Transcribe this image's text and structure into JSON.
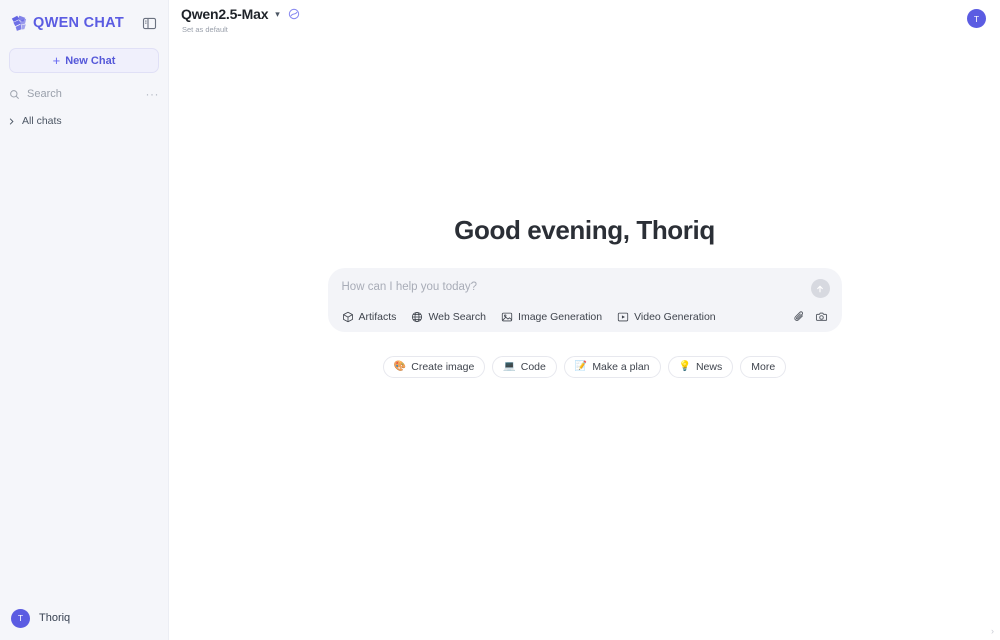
{
  "sidebar": {
    "logo_text": "QWEN CHAT",
    "panel_toggle_name": "panel-toggle-icon",
    "new_chat_label": "New Chat",
    "new_chat_plus": "+",
    "search_placeholder": "Search",
    "search_more": "···",
    "all_chats_label": "All chats",
    "profile": {
      "initial": "T",
      "name": "Thoriq"
    }
  },
  "topbar": {
    "model_name": "Qwen2.5-Max",
    "chevron": "▾",
    "set_as_default": "Set as default",
    "avatar_initial": "T"
  },
  "main": {
    "greeting": "Good evening, Thoriq",
    "composer": {
      "placeholder": "How can I help you today?",
      "send_label": "↑",
      "tools": [
        {
          "label": "Artifacts",
          "icon": "cube-icon"
        },
        {
          "label": "Web Search",
          "icon": "globe-icon"
        },
        {
          "label": "Image Generation",
          "icon": "image-icon"
        },
        {
          "label": "Video Generation",
          "icon": "video-icon"
        }
      ],
      "attach_icon": "paperclip-icon",
      "camera_icon": "camera-icon"
    },
    "chips": [
      {
        "label": "Create image",
        "emoji": "🎨"
      },
      {
        "label": "Code",
        "emoji": "💻"
      },
      {
        "label": "Make a plan",
        "emoji": "📝"
      },
      {
        "label": "News",
        "emoji": "💡"
      },
      {
        "label": "More",
        "emoji": ""
      }
    ],
    "scroll_indicator": "›"
  },
  "colors": {
    "brand": "#5b5ce2",
    "sidebar_bg": "#f5f6fa",
    "composer_bg": "#f3f4f8",
    "text_dark": "#2b2f36"
  }
}
